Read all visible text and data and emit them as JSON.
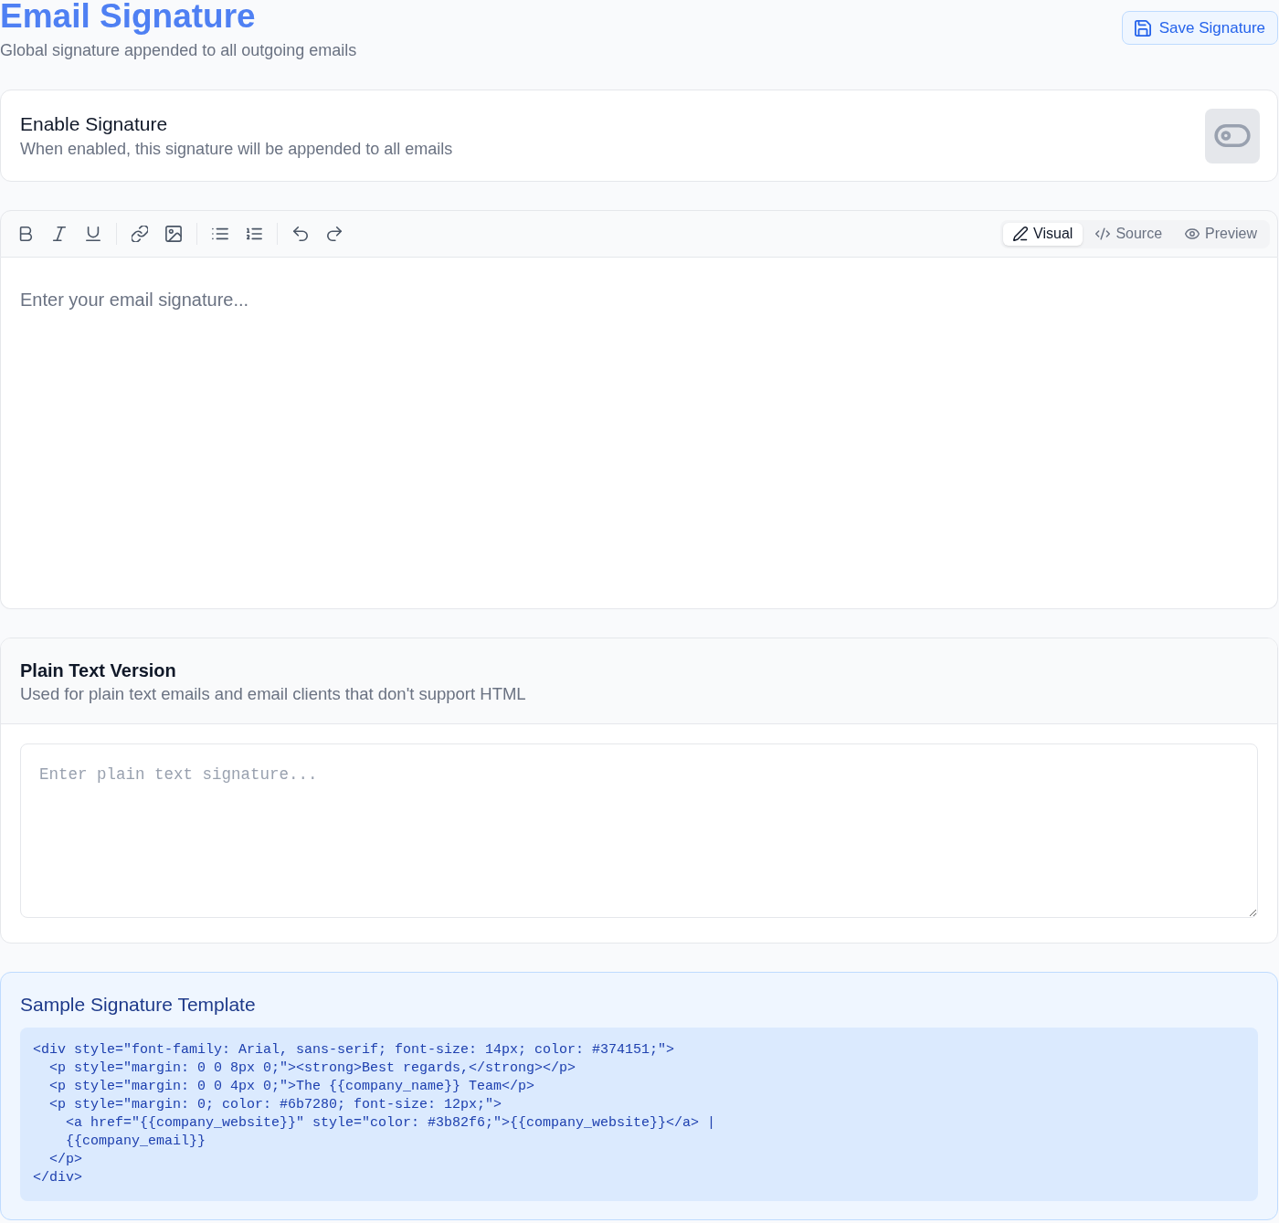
{
  "header": {
    "title": "Email Signature",
    "subtitle": "Global signature appended to all outgoing emails",
    "save_button": "Save Signature"
  },
  "enable_card": {
    "title": "Enable Signature",
    "description": "When enabled, this signature will be appended to all emails",
    "enabled": false
  },
  "editor": {
    "tabs": [
      {
        "label": "Visual",
        "selected": true
      },
      {
        "label": "Source",
        "selected": false
      },
      {
        "label": "Preview",
        "selected": false
      }
    ],
    "placeholder": "Enter your email signature..."
  },
  "plain_text": {
    "title": "Plain Text Version",
    "description": "Used for plain text emails and email clients that don't support HTML",
    "placeholder": "Enter plain text signature..."
  },
  "sample": {
    "title": "Sample Signature Template",
    "code": "<div style=\"font-family: Arial, sans-serif; font-size: 14px; color: #374151;\">\n  <p style=\"margin: 0 0 8px 0;\"><strong>Best regards,</strong></p>\n  <p style=\"margin: 0 0 4px 0;\">The {{company_name}} Team</p>\n  <p style=\"margin: 0; color: #6b7280; font-size: 12px;\">\n    <a href=\"{{company_website}}\" style=\"color: #3b82f6;\">{{company_website}}</a> |\n    {{company_email}}\n  </p>\n</div>"
  }
}
